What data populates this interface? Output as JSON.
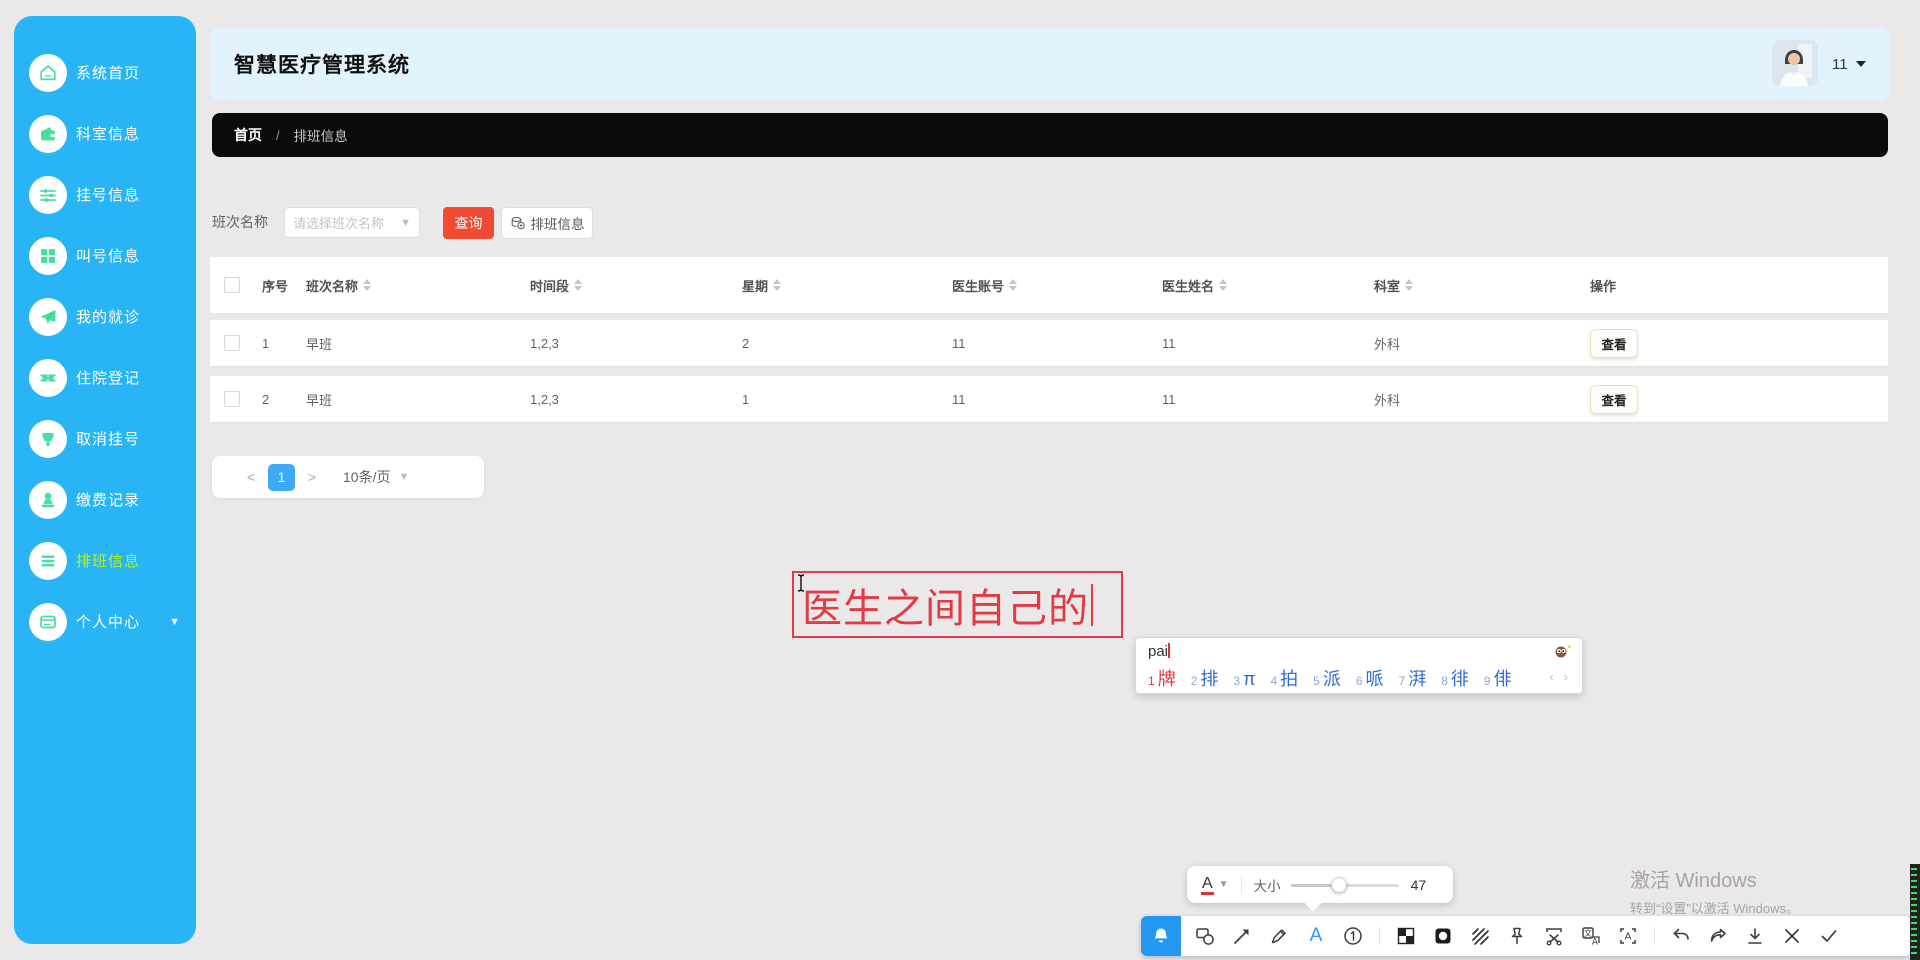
{
  "app": {
    "title": "智慧医疗管理系统"
  },
  "user": {
    "name": "11"
  },
  "sidebar": {
    "items": [
      {
        "label": "系统首页"
      },
      {
        "label": "科室信息"
      },
      {
        "label": "挂号信息"
      },
      {
        "label": "叫号信息"
      },
      {
        "label": "我的就诊"
      },
      {
        "label": "住院登记"
      },
      {
        "label": "取消挂号"
      },
      {
        "label": "缴费记录"
      },
      {
        "label": "排班信息"
      },
      {
        "label": "个人中心"
      }
    ]
  },
  "breadcrumb": {
    "home": "首页",
    "separator": "/",
    "current": "排班信息"
  },
  "filter": {
    "label": "班次名称",
    "select_placeholder": "请选择班次名称",
    "query_button": "查询",
    "info_button": "排班信息"
  },
  "table": {
    "columns": [
      {
        "label": "序号",
        "sortable": false
      },
      {
        "label": "班次名称",
        "sortable": true
      },
      {
        "label": "时间段",
        "sortable": true
      },
      {
        "label": "星期",
        "sortable": true
      },
      {
        "label": "医生账号",
        "sortable": true
      },
      {
        "label": "医生姓名",
        "sortable": true
      },
      {
        "label": "科室",
        "sortable": true
      },
      {
        "label": "操作",
        "sortable": false
      }
    ],
    "action_label": "查看",
    "rows": [
      [
        "1",
        "早班",
        "1,2,3",
        "2",
        "11",
        "11",
        "外科"
      ],
      [
        "2",
        "早班",
        "1,2,3",
        "1",
        "11",
        "11",
        "外科"
      ]
    ]
  },
  "pagination": {
    "prev": "<",
    "page": "1",
    "next": ">",
    "size": "10条/页"
  },
  "annotation": {
    "text": "医生之间自己的"
  },
  "font_popup": {
    "color_label": "A",
    "size_label": "大小",
    "size_value": "47"
  },
  "ime": {
    "composition": "pai",
    "candidates": [
      {
        "n": "1",
        "t": "牌"
      },
      {
        "n": "2",
        "t": "排"
      },
      {
        "n": "3",
        "t": "π"
      },
      {
        "n": "4",
        "t": "拍"
      },
      {
        "n": "5",
        "t": "派"
      },
      {
        "n": "6",
        "t": "哌"
      },
      {
        "n": "7",
        "t": "湃"
      },
      {
        "n": "8",
        "t": "徘"
      },
      {
        "n": "9",
        "t": "俳"
      }
    ],
    "nav_prev": "‹",
    "nav_next": "›"
  },
  "watermark": {
    "line1": "激活 Windows",
    "line2": "转到“设置”以激活 Windows。"
  },
  "colors": {
    "sidebar_blue": "#29b5f5",
    "active_item_green": "#b5f423",
    "icon_mint": "#47dfa2",
    "query_red": "#f04a34",
    "pagination_blue": "#3ea9f6",
    "annotation_red": "#e23b43",
    "ime_candidate_blue": "#2f6bd8",
    "ime_selected_red": "#d9383f",
    "toolbar_active_blue": "#2298f2"
  }
}
